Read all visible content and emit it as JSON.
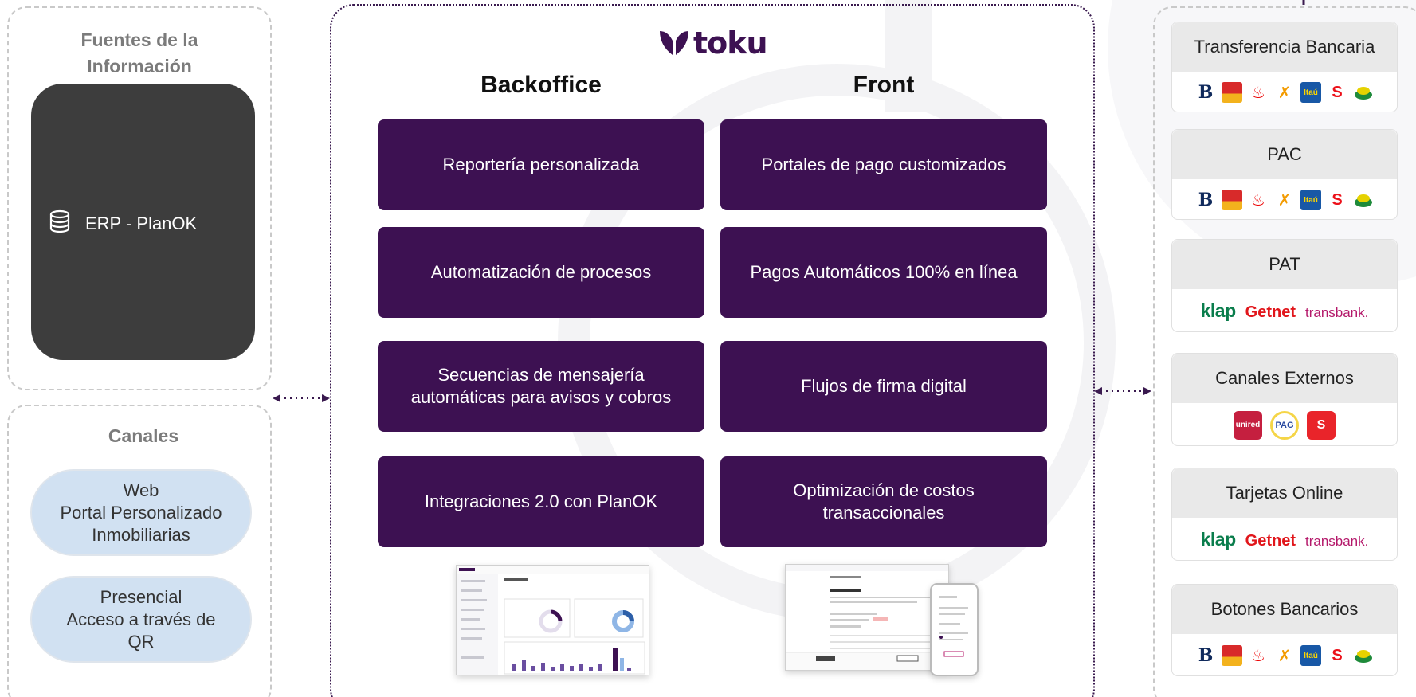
{
  "brand": {
    "name": "toku",
    "color": "#3d1152"
  },
  "sources": {
    "title": "Fuentes de la Información",
    "erp_label": "ERP - PlanOK",
    "icon": "database-icon"
  },
  "channels": {
    "title": "Canales",
    "items": [
      {
        "lines": [
          "Web",
          "Portal Personalizado",
          "Inmobiliarias"
        ]
      },
      {
        "lines": [
          "Presencial",
          "Acceso a través de",
          "QR"
        ]
      }
    ]
  },
  "backoffice": {
    "title": "Backoffice",
    "cards": [
      "Reportería personalizada",
      "Automatización de procesos",
      "Secuencias de mensajería automáticas para avisos y cobros",
      "Integraciones 2.0 con PlanOK"
    ]
  },
  "front": {
    "title": "Front",
    "cards": [
      "Portales de pago customizados",
      "Pagos Automáticos 100% en línea",
      "Flujos de firma digital",
      "Optimización de costos transaccionales"
    ]
  },
  "payment_methods": [
    {
      "name": "Transferencia Bancaria",
      "logos": "banks"
    },
    {
      "name": "PAC",
      "logos": "banks"
    },
    {
      "name": "PAT",
      "logos": "acquirers"
    },
    {
      "name": "Canales Externos",
      "logos": "channels"
    },
    {
      "name": "Tarjetas Online",
      "logos": "acquirers"
    },
    {
      "name": "Botones Bancarios",
      "logos": "banks"
    }
  ],
  "acquirers": {
    "klap": "klap",
    "getnet": "Getnet",
    "transbank": "transbank."
  },
  "external_channels": {
    "unired": "unired",
    "pag": "PAG",
    "servipag": "S"
  },
  "bank_itau": "Itaú",
  "colors": {
    "card": "#3d1152",
    "pill": "#d1e1f2",
    "erp": "#3d3d3d",
    "arrow": "#3a1a4f"
  }
}
